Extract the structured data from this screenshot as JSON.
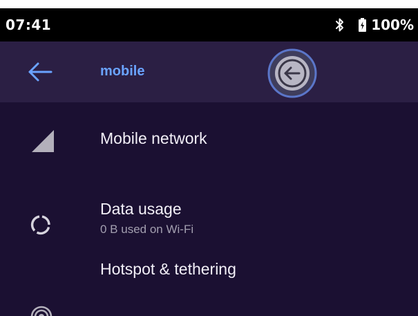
{
  "status_bar": {
    "time": "07:41",
    "bluetooth_icon": "bluetooth-icon",
    "battery_icon": "battery-icon",
    "battery_level": "100%"
  },
  "app_bar": {
    "title": "mobile",
    "back_icon": "arrow-left-icon",
    "floating_back_icon": "circled-arrow-left-icon"
  },
  "colors": {
    "background": "#1b1032",
    "app_bar": "#2b1f44",
    "accent": "#6aa3ff",
    "status_bar": "#000000",
    "title_text": "#f2eff7",
    "subtitle_text": "#a39fb0"
  },
  "menu": {
    "items": [
      {
        "icon": "signal-icon",
        "title": "Mobile network"
      },
      {
        "icon": "data-usage-icon",
        "title": "Data usage",
        "subtitle": "0 B used on Wi-Fi"
      },
      {
        "icon": "hotspot-icon",
        "title": "Hotspot & tethering"
      }
    ]
  }
}
